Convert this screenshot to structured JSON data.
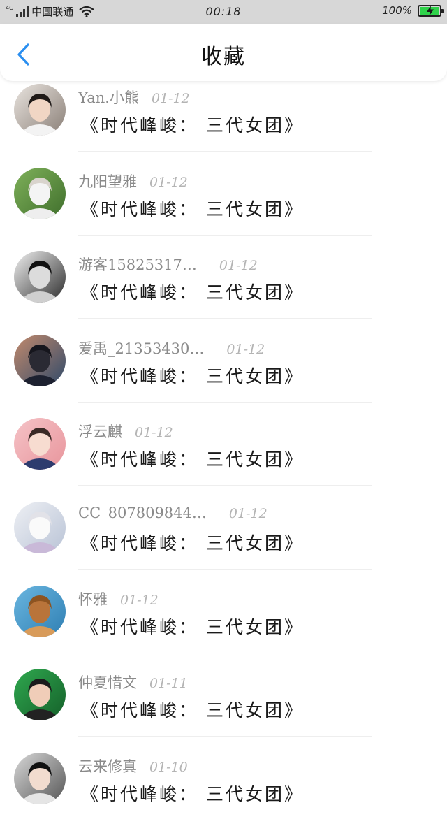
{
  "status_bar": {
    "network": "4G",
    "carrier": "中国联通",
    "time": "00:18",
    "battery": "100%",
    "battery_color": "#2fd24a"
  },
  "header": {
    "back_icon": "chevron-left-icon",
    "title": "收藏",
    "accent": "#2b8ff0"
  },
  "items": [
    {
      "user": "Yan.小熊",
      "date": "01-12",
      "text": "《时代峰峻： 三代女团》",
      "avatar": {
        "bg1": "#e9e4df",
        "bg2": "#8a7f77",
        "skin": "#f1d6c4",
        "hair": "#1f1a18",
        "body": "#f3f3f3"
      }
    },
    {
      "user": "九阳望雅",
      "date": "01-12",
      "text": "《时代峰峻： 三代女团》",
      "avatar": {
        "bg1": "#7fb15a",
        "bg2": "#3f6e2c",
        "skin": "#f4f4f4",
        "hair": "#d9d4cd",
        "body": "#eeeeee"
      }
    },
    {
      "user": "游客15825317…",
      "date": "01-12",
      "text": "《时代峰峻： 三代女团》",
      "avatar": {
        "bg1": "#f2f2f2",
        "bg2": "#2b2b2b",
        "skin": "#dcdcdc",
        "hair": "#111111",
        "body": "#cfcfcf"
      }
    },
    {
      "user": "爱禹_21353430…",
      "date": "01-12",
      "text": "《时代峰峻： 三代女团》",
      "avatar": {
        "bg1": "#c38a6c",
        "bg2": "#304a6a",
        "skin": "#2a2a33",
        "hair": "#16161d",
        "body": "#1d2130"
      }
    },
    {
      "user": "浮云麒",
      "date": "01-12",
      "text": "《时代峰峻： 三代女团》",
      "avatar": {
        "bg1": "#f5c3c7",
        "bg2": "#e8959c",
        "skin": "#f7dcd0",
        "hair": "#3a2a26",
        "body": "#2d3b6e"
      }
    },
    {
      "user": "CC_807809844…",
      "date": "01-12",
      "text": "《时代峰峻： 三代女团》",
      "avatar": {
        "bg1": "#eef0f4",
        "bg2": "#b9c3d6",
        "skin": "#fafafa",
        "hair": "#e2e2e8",
        "body": "#c9b9d8"
      }
    },
    {
      "user": "怀雅",
      "date": "01-12",
      "text": "《时代峰峻： 三代女团》",
      "avatar": {
        "bg1": "#6ab6e0",
        "bg2": "#2f7fb3",
        "skin": "#b9743a",
        "hair": "#8d5421",
        "body": "#d89b5a"
      }
    },
    {
      "user": "仲夏惜文",
      "date": "01-11",
      "text": "《时代峰峻： 三代女团》",
      "avatar": {
        "bg1": "#2fa84f",
        "bg2": "#15602a",
        "skin": "#f0cdb8",
        "hair": "#1b1b1b",
        "body": "#222222"
      }
    },
    {
      "user": "云来修真",
      "date": "01-10",
      "text": "《时代峰峻： 三代女团》",
      "avatar": {
        "bg1": "#d8d8d8",
        "bg2": "#555555",
        "skin": "#f2dccf",
        "hair": "#111111",
        "body": "#e5e5e5"
      }
    }
  ]
}
